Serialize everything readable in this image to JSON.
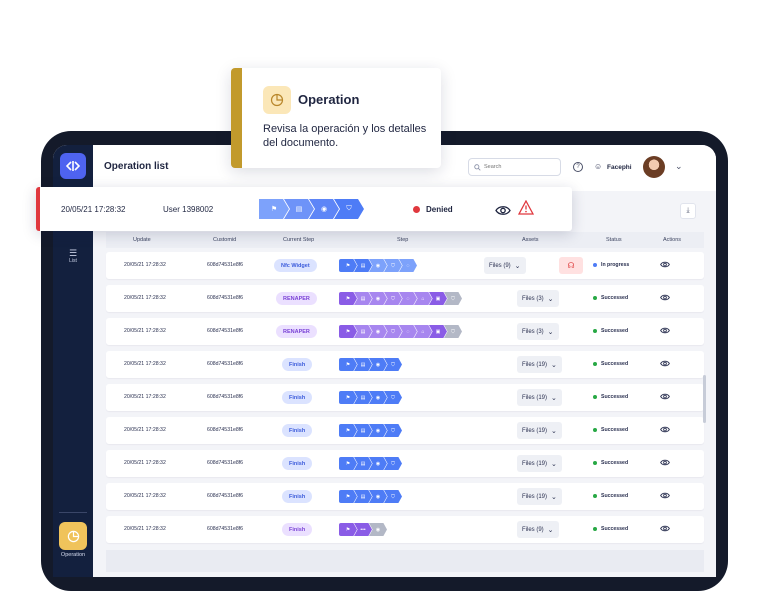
{
  "app": {
    "page_title": "Operation list",
    "search_placeholder": "Search",
    "user_name": "Facephi",
    "help_label": "?"
  },
  "sidebar": {
    "list_label": "List",
    "operation_label": "Operation"
  },
  "tooltip": {
    "title": "Operation",
    "body": "Revisa la operación y los detalles del documento."
  },
  "highlight_row": {
    "date": "20/05/21 17:28:32",
    "user": "User 1398002",
    "status": "Denied",
    "status_color": "#e0383e"
  },
  "table": {
    "headers": [
      "Update",
      "Customid",
      "Current Step",
      "Step",
      "Assets",
      "Status",
      "Actions"
    ],
    "rows": [
      {
        "update": "20/05/21 17:28:32",
        "customid": "608d74531e8f6",
        "current_step": "Nfc Widget",
        "step_color": "blue",
        "steps": [
          "blue",
          "blue",
          "lblue",
          "lblue",
          "lblue"
        ],
        "files": "Files (9)",
        "support": true,
        "status": "In progress",
        "status_color": "#4e7cf6"
      },
      {
        "update": "20/05/21 17:28:32",
        "customid": "608d74531e8f6",
        "current_step": "RENAPER",
        "step_color": "purple",
        "steps": [
          "purple",
          "lpurple",
          "lpurple",
          "lpurple",
          "lpurple",
          "lpurple",
          "purple",
          "gray"
        ],
        "files": "Files (3)",
        "support": false,
        "status": "Successed",
        "status_color": "#27a844"
      },
      {
        "update": "20/05/21 17:28:32",
        "customid": "608d74531e8f6",
        "current_step": "RENAPER",
        "step_color": "purple",
        "steps": [
          "purple",
          "lpurple",
          "lpurple",
          "lpurple",
          "lpurple",
          "lpurple",
          "purple",
          "gray"
        ],
        "files": "Files (3)",
        "support": false,
        "status": "Successed",
        "status_color": "#27a844"
      },
      {
        "update": "20/05/21 17:28:32",
        "customid": "608d74531e8f6",
        "current_step": "Finish",
        "step_color": "blue",
        "steps": [
          "blue",
          "blue",
          "blue",
          "blue"
        ],
        "files": "Files (19)",
        "support": false,
        "status": "Successed",
        "status_color": "#27a844"
      },
      {
        "update": "20/05/21 17:28:32",
        "customid": "608d74531e8f6",
        "current_step": "Finish",
        "step_color": "blue",
        "steps": [
          "blue",
          "blue",
          "blue",
          "blue"
        ],
        "files": "Files (19)",
        "support": false,
        "status": "Successed",
        "status_color": "#27a844"
      },
      {
        "update": "20/05/21 17:28:32",
        "customid": "608d74531e8f6",
        "current_step": "Finish",
        "step_color": "blue",
        "steps": [
          "blue",
          "blue",
          "blue",
          "blue"
        ],
        "files": "Files (19)",
        "support": false,
        "status": "Successed",
        "status_color": "#27a844"
      },
      {
        "update": "20/05/21 17:28:32",
        "customid": "608d74531e8f6",
        "current_step": "Finish",
        "step_color": "blue",
        "steps": [
          "blue",
          "blue",
          "blue",
          "blue"
        ],
        "files": "Files (19)",
        "support": false,
        "status": "Successed",
        "status_color": "#27a844"
      },
      {
        "update": "20/05/21 17:28:32",
        "customid": "608d74531e8f6",
        "current_step": "Finish",
        "step_color": "blue",
        "steps": [
          "blue",
          "blue",
          "blue",
          "blue"
        ],
        "files": "Files (19)",
        "support": false,
        "status": "Successed",
        "status_color": "#27a844"
      },
      {
        "update": "20/05/21 17:28:32",
        "customid": "608d74531e8f6",
        "current_step": "Finish",
        "step_color": "purple",
        "steps": [
          "purple",
          "purple",
          "gray"
        ],
        "files": "Files (9)",
        "support": false,
        "status": "Successed",
        "status_color": "#27a844"
      }
    ]
  }
}
